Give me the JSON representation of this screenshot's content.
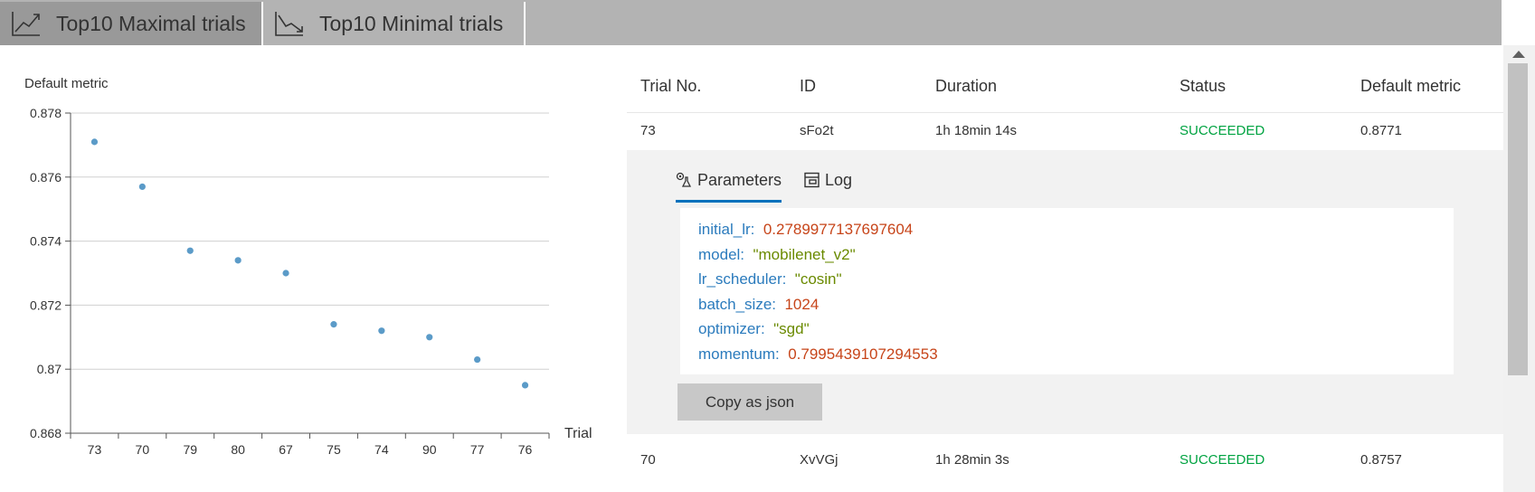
{
  "tabs": [
    {
      "label": "Top10 Maximal trials",
      "icon": "trend-up-icon",
      "active": true
    },
    {
      "label": "Top10 Minimal trials",
      "icon": "trend-down-icon",
      "active": false
    }
  ],
  "chart_data": {
    "type": "scatter",
    "ylabel": "Default metric",
    "xlabel": "Trial",
    "categories": [
      "73",
      "70",
      "79",
      "80",
      "67",
      "75",
      "74",
      "90",
      "77",
      "76"
    ],
    "values": [
      0.8771,
      0.8757,
      0.8737,
      0.8734,
      0.873,
      0.8714,
      0.8712,
      0.871,
      0.8703,
      0.8695
    ],
    "ylim": [
      0.868,
      0.878
    ],
    "yticks": [
      "0.868",
      "0.87",
      "0.872",
      "0.874",
      "0.876",
      "0.878"
    ],
    "grid": true,
    "color": "#5b9bc8"
  },
  "table": {
    "headers": [
      "Trial No.",
      "ID",
      "Duration",
      "Status",
      "Default metric"
    ],
    "rows": [
      {
        "trial": "73",
        "id": "sFo2t",
        "duration": "1h 18min 14s",
        "status": "SUCCEEDED",
        "metric": "0.8771"
      },
      {
        "trial": "70",
        "id": "XvVGj",
        "duration": "1h 28min 3s",
        "status": "SUCCEEDED",
        "metric": "0.8757"
      }
    ],
    "status_color": "#00a341"
  },
  "detail": {
    "tabs": [
      {
        "label": "Parameters",
        "icon": "parameters-icon",
        "active": true
      },
      {
        "label": "Log",
        "icon": "log-icon",
        "active": false
      }
    ],
    "params": [
      {
        "key": "initial_lr:",
        "value": "0.2789977137697604",
        "kind": "num"
      },
      {
        "key": "model:",
        "value": "\"mobilenet_v2\"",
        "kind": "str"
      },
      {
        "key": "lr_scheduler:",
        "value": "\"cosin\"",
        "kind": "str"
      },
      {
        "key": "batch_size:",
        "value": "1024",
        "kind": "num"
      },
      {
        "key": "optimizer:",
        "value": "\"sgd\"",
        "kind": "str"
      },
      {
        "key": "momentum:",
        "value": "0.7995439107294553",
        "kind": "num"
      }
    ],
    "copy_label": "Copy as json"
  }
}
